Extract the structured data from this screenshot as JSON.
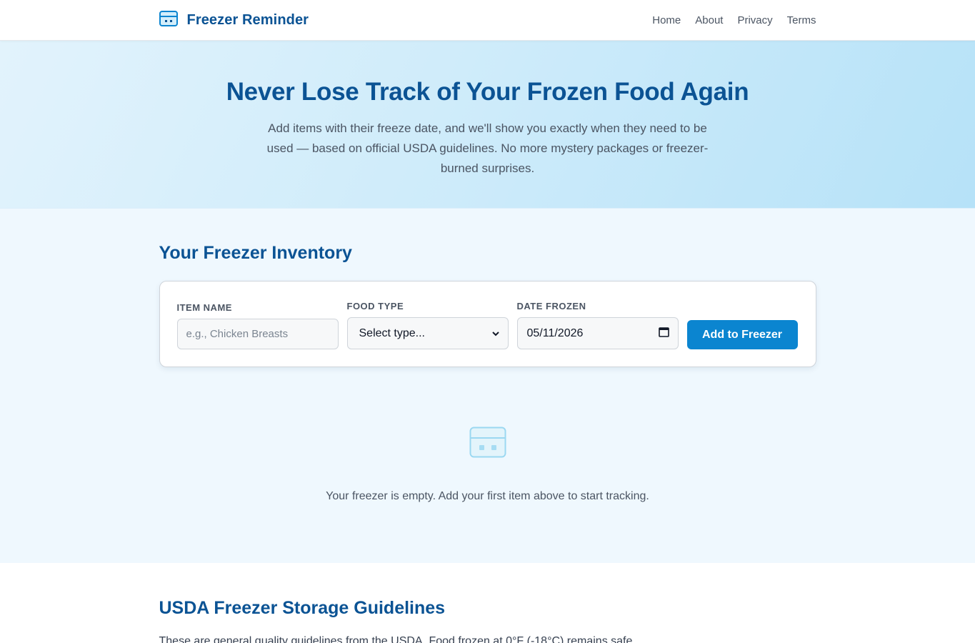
{
  "header": {
    "brand_name": "Freezer Reminder",
    "brand_icon": "freezer-icon",
    "nav": [
      "Home",
      "About",
      "Privacy",
      "Terms"
    ]
  },
  "hero": {
    "title": "Never Lose Track of Your Frozen Food Again",
    "subtitle": "Add items with their freeze date, and we'll show you exactly when they need to be used — based on official USDA guidelines. No more mystery packages or freezer-burned surprises."
  },
  "inventory": {
    "title": "Your Freezer Inventory",
    "form": {
      "item_name_label": "ITEM NAME",
      "item_name_placeholder": "e.g., Chicken Breasts",
      "item_name_value": "",
      "food_type_label": "FOOD TYPE",
      "food_type_selected": "Select type...",
      "date_frozen_label": "DATE FROZEN",
      "date_frozen_value": "05/11/2026",
      "submit_label": "Add to Freezer"
    },
    "empty_state": {
      "icon": "freezer-icon",
      "text": "Your freezer is empty. Add your first item above to start tracking."
    }
  },
  "guidelines": {
    "title": "USDA Freezer Storage Guidelines",
    "intro": "These are general quality guidelines from the USDA. Food frozen at 0°F (-18°C) remains safe"
  },
  "colors": {
    "brand": "#0b5394",
    "accent": "#0b85d0",
    "hero_bg": "#cdebfa",
    "inventory_bg": "#eff8fe"
  }
}
